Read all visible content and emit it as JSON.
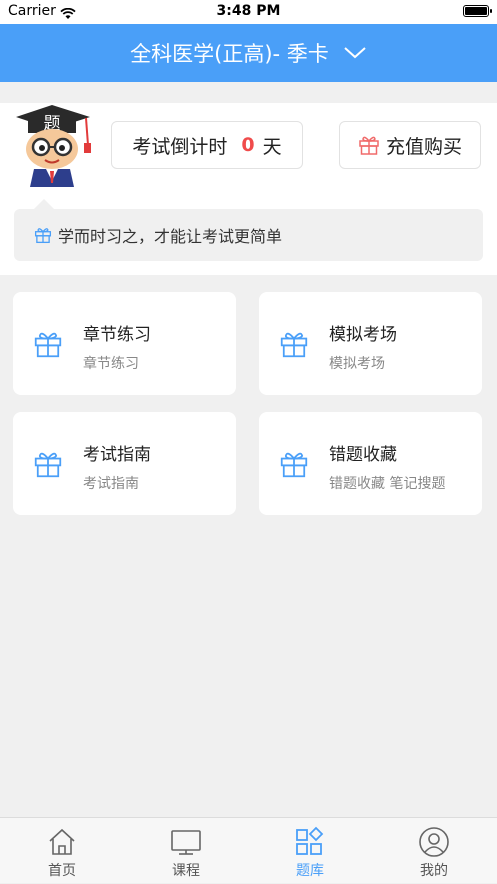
{
  "status_bar": {
    "carrier": "Carrier",
    "time": "3:48 PM"
  },
  "header": {
    "title": "全科医学(正高)- 季卡",
    "background_color": "#4a9ff8"
  },
  "mascot": {
    "hat_text": "题"
  },
  "countdown": {
    "label": "考试倒计时",
    "value": "0",
    "unit": "天",
    "value_color": "#f04b4b"
  },
  "recharge": {
    "label": "充值购买",
    "icon": "gift-icon"
  },
  "slogan": {
    "text": "学而时习之，才能让考试更简单",
    "icon": "gift-icon"
  },
  "cards": [
    {
      "title": "章节练习",
      "subtitle": "章节练习",
      "icon": "gift-icon"
    },
    {
      "title": "模拟考场",
      "subtitle": "模拟考场",
      "icon": "gift-icon"
    },
    {
      "title": "考试指南",
      "subtitle": "考试指南",
      "icon": "gift-icon"
    },
    {
      "title": "错题收藏",
      "subtitle": "错题收藏 笔记搜题",
      "icon": "gift-icon"
    }
  ],
  "tab_bar": {
    "items": [
      {
        "label": "首页",
        "icon": "home-icon",
        "active": false
      },
      {
        "label": "课程",
        "icon": "tv-icon",
        "active": false
      },
      {
        "label": "题库",
        "icon": "grid-icon",
        "active": true
      },
      {
        "label": "我的",
        "icon": "user-icon",
        "active": false
      }
    ],
    "active_color": "#4a9ff8"
  }
}
